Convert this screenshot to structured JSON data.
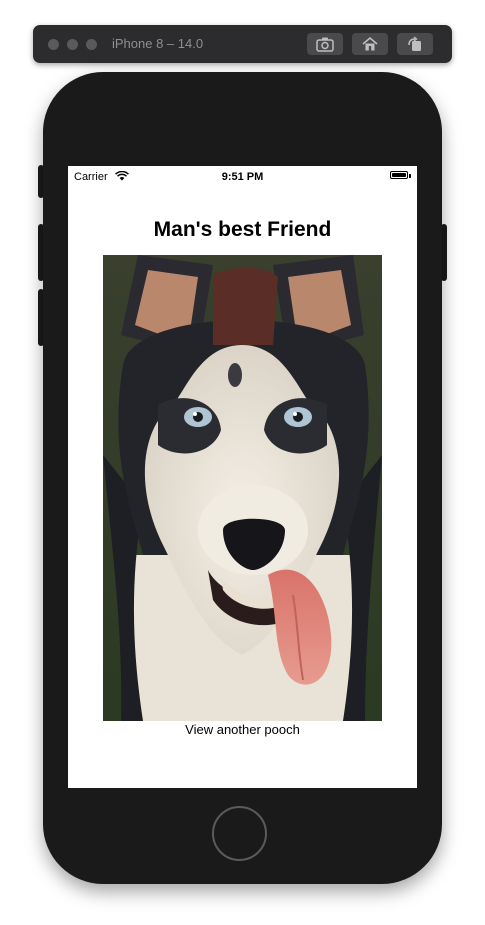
{
  "simulator": {
    "title": "iPhone 8 – 14.0",
    "buttons": [
      "screenshot-icon",
      "home-icon",
      "rotate-icon"
    ]
  },
  "status_bar": {
    "carrier": "Carrier",
    "time": "9:51 PM"
  },
  "app": {
    "title": "Man's best Friend",
    "image_label": "husky-dog-photo",
    "button_label": "View another pooch"
  },
  "colors": {
    "device_body": "#1a1a1a",
    "sim_bar": "#2c2c2e",
    "screen_bg": "#ffffff"
  }
}
